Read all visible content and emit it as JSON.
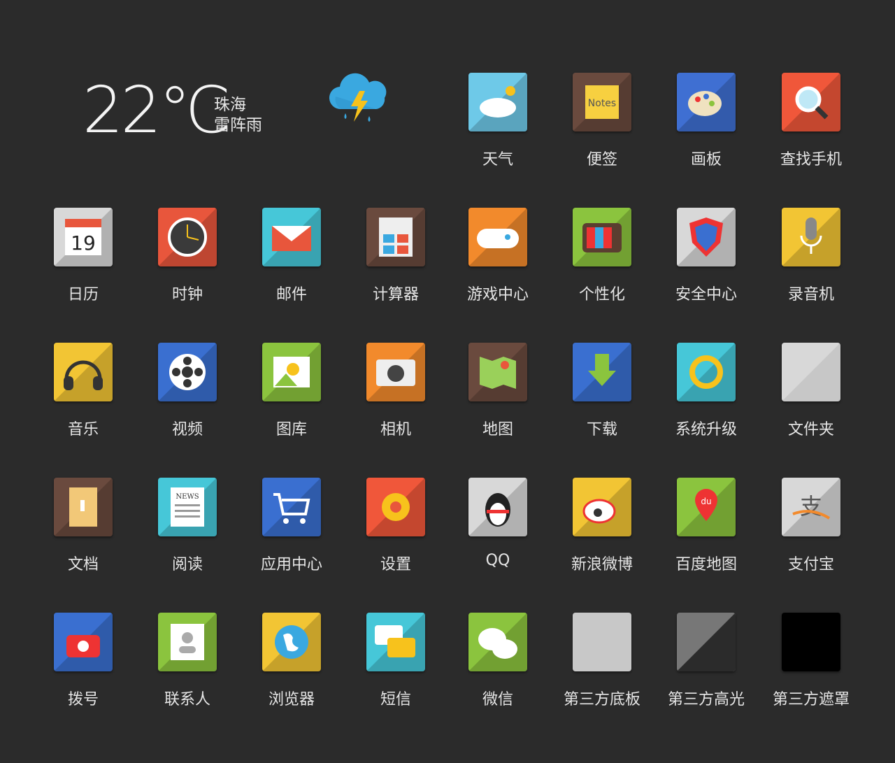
{
  "weather": {
    "temperature": "22℃",
    "city": "珠海",
    "condition": "雷阵雨",
    "icon": "thunderstorm-cloud-icon"
  },
  "apps": [
    {
      "label": "天气",
      "icon": "weather-icon",
      "bg": "#6ec9e8"
    },
    {
      "label": "便签",
      "icon": "notes-icon",
      "bg": "#6a4a3e"
    },
    {
      "label": "画板",
      "icon": "palette-icon",
      "bg": "#3f6fd2"
    },
    {
      "label": "查找手机",
      "icon": "search-phone-icon",
      "bg": "#f0573a"
    },
    {
      "label": "日历",
      "icon": "calendar-icon",
      "bg": "#d8d8d8"
    },
    {
      "label": "时钟",
      "icon": "clock-icon",
      "bg": "#e8563c"
    },
    {
      "label": "邮件",
      "icon": "mail-icon",
      "bg": "#46c7d8"
    },
    {
      "label": "计算器",
      "icon": "calculator-icon",
      "bg": "#6a4a3e"
    },
    {
      "label": "游戏中心",
      "icon": "gamepad-icon",
      "bg": "#f28a2c"
    },
    {
      "label": "个性化",
      "icon": "tv-icon",
      "bg": "#8bc43e"
    },
    {
      "label": "安全中心",
      "icon": "shield-icon",
      "bg": "#d8d8d8"
    },
    {
      "label": "录音机",
      "icon": "microphone-icon",
      "bg": "#f2c534"
    },
    {
      "label": "音乐",
      "icon": "headphones-icon",
      "bg": "#f2c534"
    },
    {
      "label": "视频",
      "icon": "film-reel-icon",
      "bg": "#3a6fd0"
    },
    {
      "label": "图库",
      "icon": "gallery-icon",
      "bg": "#8bc43e"
    },
    {
      "label": "相机",
      "icon": "camera-icon",
      "bg": "#f28a2c"
    },
    {
      "label": "地图",
      "icon": "map-icon",
      "bg": "#6a4a3e"
    },
    {
      "label": "下载",
      "icon": "download-icon",
      "bg": "#3a6fd0"
    },
    {
      "label": "系统升级",
      "icon": "update-icon",
      "bg": "#46c7d8"
    },
    {
      "label": "文件夹",
      "icon": "folder-icon",
      "bg": "#d8d8d8"
    },
    {
      "label": "文档",
      "icon": "document-icon",
      "bg": "#6a4a3e"
    },
    {
      "label": "阅读",
      "icon": "news-icon",
      "bg": "#46c7d8"
    },
    {
      "label": "应用中心",
      "icon": "cart-icon",
      "bg": "#3a6fd0"
    },
    {
      "label": "设置",
      "icon": "gear-icon",
      "bg": "#f0573a"
    },
    {
      "label": "QQ",
      "icon": "qq-penguin-icon",
      "bg": "#d8d8d8"
    },
    {
      "label": "新浪微博",
      "icon": "weibo-icon",
      "bg": "#f2c534"
    },
    {
      "label": "百度地图",
      "icon": "baidu-map-icon",
      "bg": "#8bc43e"
    },
    {
      "label": "支付宝",
      "icon": "alipay-icon",
      "bg": "#d8d8d8"
    },
    {
      "label": "拨号",
      "icon": "phone-icon",
      "bg": "#3a6fd0"
    },
    {
      "label": "联系人",
      "icon": "contacts-icon",
      "bg": "#8bc43e"
    },
    {
      "label": "浏览器",
      "icon": "globe-icon",
      "bg": "#f2c534"
    },
    {
      "label": "短信",
      "icon": "message-icon",
      "bg": "#46c7d8"
    },
    {
      "label": "微信",
      "icon": "wechat-icon",
      "bg": "#8bc43e"
    },
    {
      "label": "第三方底板",
      "icon": "base-plate-icon",
      "bg": "#c8c8c8"
    },
    {
      "label": "第三方高光",
      "icon": "highlight-icon",
      "bg": "#777777"
    },
    {
      "label": "第三方遮罩",
      "icon": "mask-icon",
      "bg": "#000000"
    }
  ]
}
